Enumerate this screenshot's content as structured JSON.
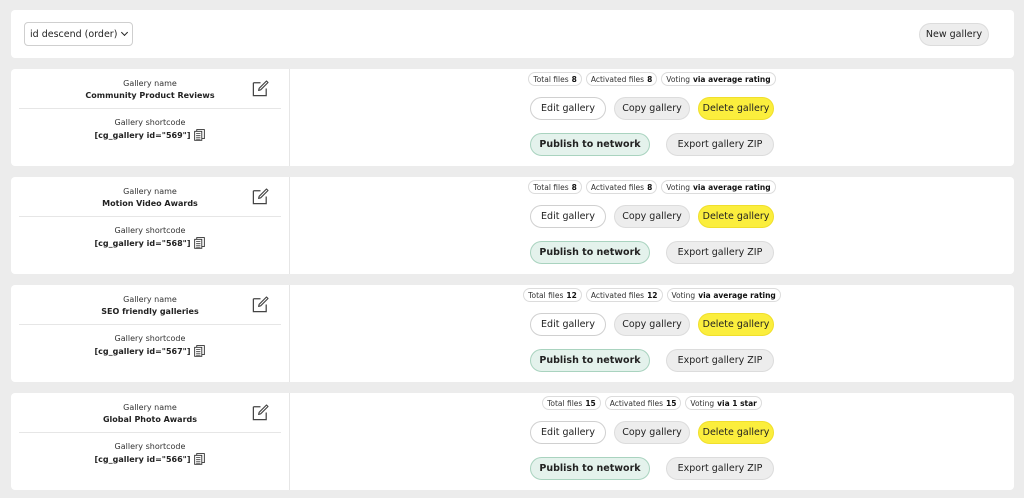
{
  "toolbar": {
    "sort_value": "id descend (order)",
    "new_gallery_label": "New gallery"
  },
  "labels": {
    "gallery_name": "Gallery name",
    "gallery_shortcode": "Gallery shortcode",
    "total_files": "Total files",
    "activated_files": "Activated files",
    "voting": "Voting",
    "edit_gallery": "Edit gallery",
    "copy_gallery": "Copy gallery",
    "delete_gallery": "Delete gallery",
    "publish_to_network": "Publish to network",
    "export_gallery_zip": "Export gallery ZIP"
  },
  "galleries": [
    {
      "name": "Community Product Reviews",
      "shortcode": "[cg_gallery id=\"569\"]",
      "total_files": "8",
      "activated_files": "8",
      "voting": "via average rating"
    },
    {
      "name": "Motion Video Awards",
      "shortcode": "[cg_gallery id=\"568\"]",
      "total_files": "8",
      "activated_files": "8",
      "voting": "via average rating"
    },
    {
      "name": "SEO friendly galleries",
      "shortcode": "[cg_gallery id=\"567\"]",
      "total_files": "12",
      "activated_files": "12",
      "voting": "via average rating"
    },
    {
      "name": "Global Photo Awards",
      "shortcode": "[cg_gallery id=\"566\"]",
      "total_files": "15",
      "activated_files": "15",
      "voting": "via 1 star"
    }
  ],
  "colors": {
    "delete_button": "#fbee3d",
    "publish_button": "#e4f2ec",
    "page_background": "#ececec"
  }
}
